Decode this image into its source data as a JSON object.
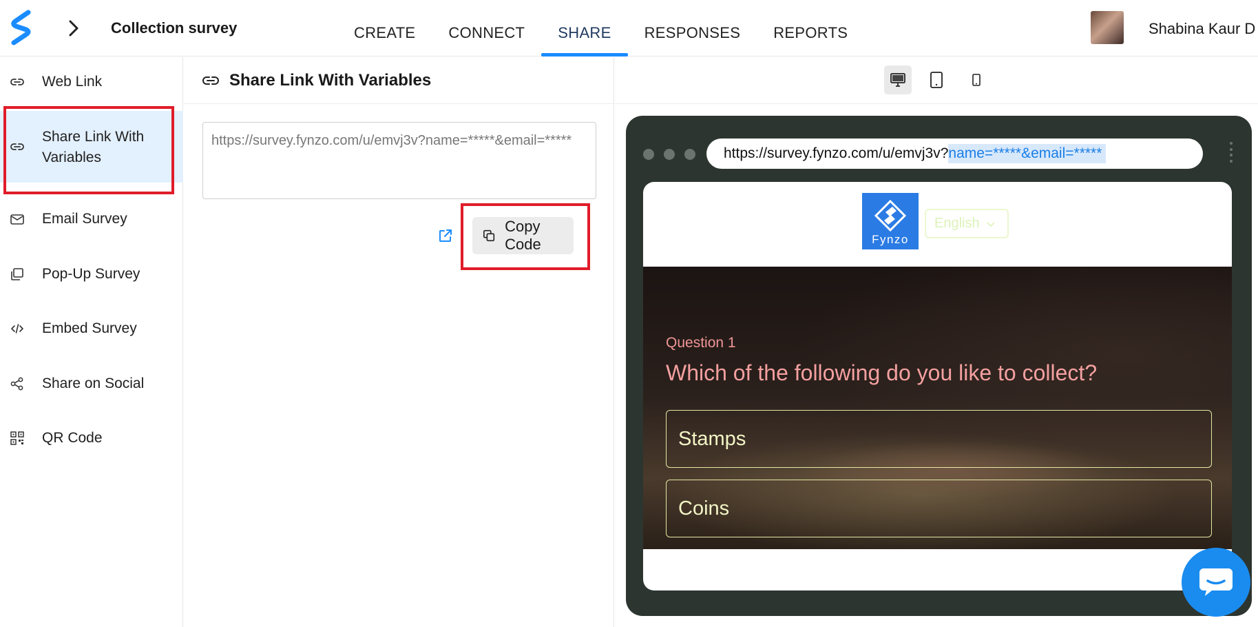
{
  "header": {
    "survey_title": "Collection survey",
    "nav_tabs": [
      {
        "label": "CREATE"
      },
      {
        "label": "CONNECT"
      },
      {
        "label": "SHARE"
      },
      {
        "label": "RESPONSES"
      },
      {
        "label": "REPORTS"
      }
    ],
    "active_tab": "SHARE",
    "user_name": "Shabina Kaur D"
  },
  "sidebar": {
    "items": [
      {
        "label": "Web Link",
        "icon": "link-icon"
      },
      {
        "label": "Share Link With Variables",
        "icon": "link-icon"
      },
      {
        "label": "Email Survey",
        "icon": "mail-icon"
      },
      {
        "label": "Pop-Up Survey",
        "icon": "popup-icon"
      },
      {
        "label": "Embed Survey",
        "icon": "code-icon"
      },
      {
        "label": "Share on Social",
        "icon": "share-icon"
      },
      {
        "label": "QR Code",
        "icon": "qr-code-icon"
      }
    ],
    "active_item": "Share Link With Variables"
  },
  "panel": {
    "title": "Share Link With Variables",
    "link_value": "https://survey.fynzo.com/u/emvj3v?name=*****&email=*****",
    "copy_button_label": "Copy Code"
  },
  "preview": {
    "url_base": "https://survey.fynzo.com/u/emvj3v?",
    "url_params": "name=*****&email=*****",
    "logo_text": "Fynzo",
    "language": "English",
    "question_number": "Question 1",
    "question_text": "Which of the following do you like to collect?",
    "options": [
      "Stamps",
      "Coins"
    ]
  },
  "colors": {
    "accent": "#1a8cff",
    "highlight_box": "#e01c2a",
    "question_text": "#f4a0a0",
    "option_text": "#f3f5c7",
    "preview_frame": "#2d3530"
  }
}
